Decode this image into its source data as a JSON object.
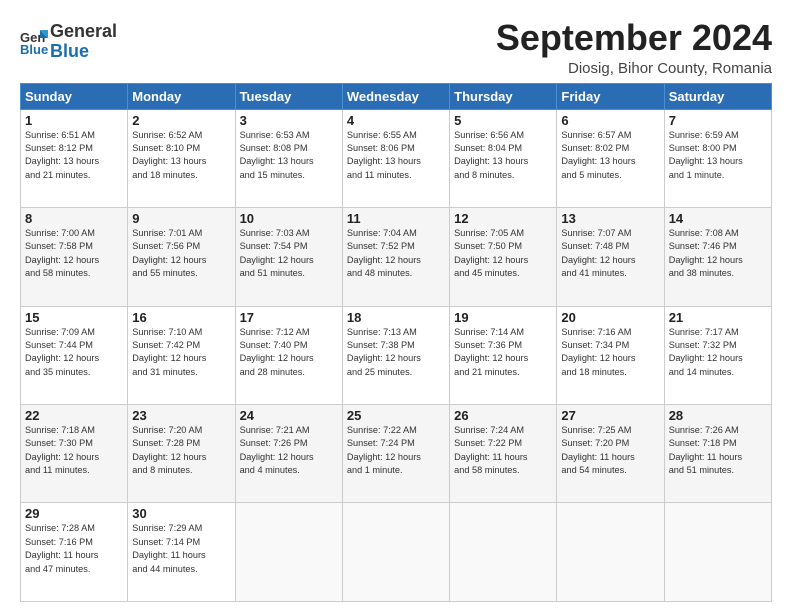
{
  "header": {
    "logo_line1": "General",
    "logo_line2": "Blue",
    "month": "September 2024",
    "location": "Diosig, Bihor County, Romania"
  },
  "weekdays": [
    "Sunday",
    "Monday",
    "Tuesday",
    "Wednesday",
    "Thursday",
    "Friday",
    "Saturday"
  ],
  "weeks": [
    [
      {
        "day": "1",
        "info": "Sunrise: 6:51 AM\nSunset: 8:12 PM\nDaylight: 13 hours\nand 21 minutes."
      },
      {
        "day": "2",
        "info": "Sunrise: 6:52 AM\nSunset: 8:10 PM\nDaylight: 13 hours\nand 18 minutes."
      },
      {
        "day": "3",
        "info": "Sunrise: 6:53 AM\nSunset: 8:08 PM\nDaylight: 13 hours\nand 15 minutes."
      },
      {
        "day": "4",
        "info": "Sunrise: 6:55 AM\nSunset: 8:06 PM\nDaylight: 13 hours\nand 11 minutes."
      },
      {
        "day": "5",
        "info": "Sunrise: 6:56 AM\nSunset: 8:04 PM\nDaylight: 13 hours\nand 8 minutes."
      },
      {
        "day": "6",
        "info": "Sunrise: 6:57 AM\nSunset: 8:02 PM\nDaylight: 13 hours\nand 5 minutes."
      },
      {
        "day": "7",
        "info": "Sunrise: 6:59 AM\nSunset: 8:00 PM\nDaylight: 13 hours\nand 1 minute."
      }
    ],
    [
      {
        "day": "8",
        "info": "Sunrise: 7:00 AM\nSunset: 7:58 PM\nDaylight: 12 hours\nand 58 minutes."
      },
      {
        "day": "9",
        "info": "Sunrise: 7:01 AM\nSunset: 7:56 PM\nDaylight: 12 hours\nand 55 minutes."
      },
      {
        "day": "10",
        "info": "Sunrise: 7:03 AM\nSunset: 7:54 PM\nDaylight: 12 hours\nand 51 minutes."
      },
      {
        "day": "11",
        "info": "Sunrise: 7:04 AM\nSunset: 7:52 PM\nDaylight: 12 hours\nand 48 minutes."
      },
      {
        "day": "12",
        "info": "Sunrise: 7:05 AM\nSunset: 7:50 PM\nDaylight: 12 hours\nand 45 minutes."
      },
      {
        "day": "13",
        "info": "Sunrise: 7:07 AM\nSunset: 7:48 PM\nDaylight: 12 hours\nand 41 minutes."
      },
      {
        "day": "14",
        "info": "Sunrise: 7:08 AM\nSunset: 7:46 PM\nDaylight: 12 hours\nand 38 minutes."
      }
    ],
    [
      {
        "day": "15",
        "info": "Sunrise: 7:09 AM\nSunset: 7:44 PM\nDaylight: 12 hours\nand 35 minutes."
      },
      {
        "day": "16",
        "info": "Sunrise: 7:10 AM\nSunset: 7:42 PM\nDaylight: 12 hours\nand 31 minutes."
      },
      {
        "day": "17",
        "info": "Sunrise: 7:12 AM\nSunset: 7:40 PM\nDaylight: 12 hours\nand 28 minutes."
      },
      {
        "day": "18",
        "info": "Sunrise: 7:13 AM\nSunset: 7:38 PM\nDaylight: 12 hours\nand 25 minutes."
      },
      {
        "day": "19",
        "info": "Sunrise: 7:14 AM\nSunset: 7:36 PM\nDaylight: 12 hours\nand 21 minutes."
      },
      {
        "day": "20",
        "info": "Sunrise: 7:16 AM\nSunset: 7:34 PM\nDaylight: 12 hours\nand 18 minutes."
      },
      {
        "day": "21",
        "info": "Sunrise: 7:17 AM\nSunset: 7:32 PM\nDaylight: 12 hours\nand 14 minutes."
      }
    ],
    [
      {
        "day": "22",
        "info": "Sunrise: 7:18 AM\nSunset: 7:30 PM\nDaylight: 12 hours\nand 11 minutes."
      },
      {
        "day": "23",
        "info": "Sunrise: 7:20 AM\nSunset: 7:28 PM\nDaylight: 12 hours\nand 8 minutes."
      },
      {
        "day": "24",
        "info": "Sunrise: 7:21 AM\nSunset: 7:26 PM\nDaylight: 12 hours\nand 4 minutes."
      },
      {
        "day": "25",
        "info": "Sunrise: 7:22 AM\nSunset: 7:24 PM\nDaylight: 12 hours\nand 1 minute."
      },
      {
        "day": "26",
        "info": "Sunrise: 7:24 AM\nSunset: 7:22 PM\nDaylight: 11 hours\nand 58 minutes."
      },
      {
        "day": "27",
        "info": "Sunrise: 7:25 AM\nSunset: 7:20 PM\nDaylight: 11 hours\nand 54 minutes."
      },
      {
        "day": "28",
        "info": "Sunrise: 7:26 AM\nSunset: 7:18 PM\nDaylight: 11 hours\nand 51 minutes."
      }
    ],
    [
      {
        "day": "29",
        "info": "Sunrise: 7:28 AM\nSunset: 7:16 PM\nDaylight: 11 hours\nand 47 minutes."
      },
      {
        "day": "30",
        "info": "Sunrise: 7:29 AM\nSunset: 7:14 PM\nDaylight: 11 hours\nand 44 minutes."
      },
      {
        "day": "",
        "info": ""
      },
      {
        "day": "",
        "info": ""
      },
      {
        "day": "",
        "info": ""
      },
      {
        "day": "",
        "info": ""
      },
      {
        "day": "",
        "info": ""
      }
    ]
  ]
}
